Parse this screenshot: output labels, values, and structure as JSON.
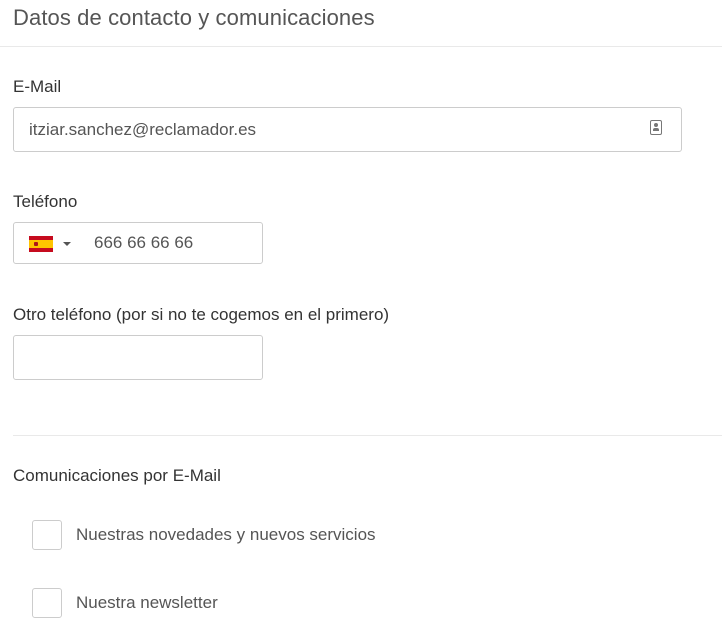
{
  "section": {
    "title": "Datos de contacto y comunicaciones"
  },
  "email": {
    "label": "E-Mail",
    "value": "itziar.sanchez@reclamador.es",
    "icon": "contact-card-icon"
  },
  "phone": {
    "label": "Teléfono",
    "country_flag": "ES",
    "value": "666 66 66 66"
  },
  "other_phone": {
    "label": "Otro teléfono (por si no te cogemos en el primero)",
    "value": ""
  },
  "communications": {
    "title": "Comunicaciones por E-Mail",
    "options": [
      {
        "label": "Nuestras novedades y nuevos servicios",
        "checked": false
      },
      {
        "label": "Nuestra newsletter",
        "checked": false
      }
    ]
  },
  "colors": {
    "border": "#cccccc",
    "divider": "#e9e9e9",
    "text": "#333333",
    "muted_text": "#555555"
  }
}
